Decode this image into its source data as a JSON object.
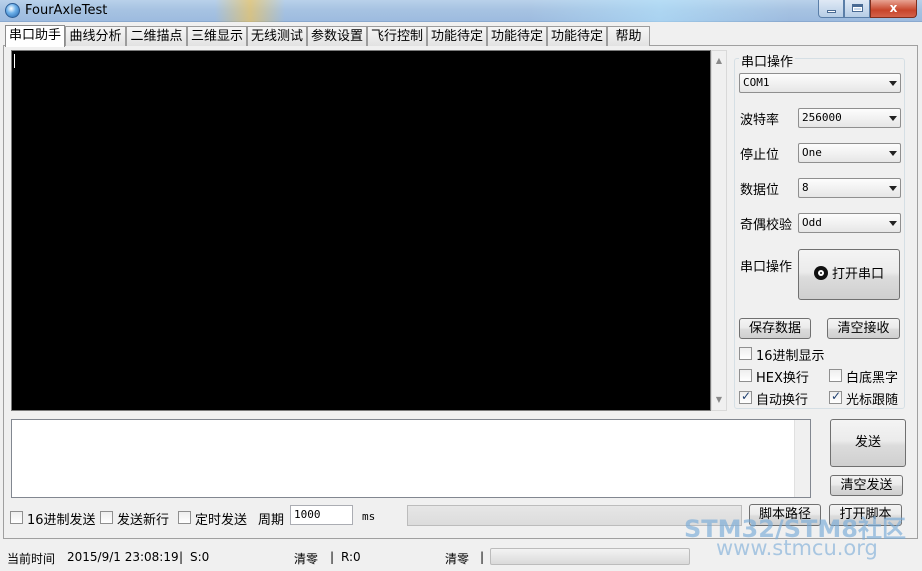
{
  "window": {
    "title": "FourAxleTest",
    "controls": {
      "minimize": "",
      "maximize": "",
      "close": "x"
    }
  },
  "tabs": [
    {
      "label": "串口助手",
      "active": true
    },
    {
      "label": "曲线分析"
    },
    {
      "label": "二维描点"
    },
    {
      "label": "三维显示"
    },
    {
      "label": "无线测试"
    },
    {
      "label": "参数设置"
    },
    {
      "label": "飞行控制"
    },
    {
      "label": "功能待定"
    },
    {
      "label": "功能待定"
    },
    {
      "label": "功能待定"
    },
    {
      "label": "帮助"
    }
  ],
  "serial": {
    "group_title": "串口操作",
    "port_value": "COM1",
    "baud_label": "波特率",
    "baud_value": "256000",
    "stopbits_label": "停止位",
    "stopbits_value": "One",
    "databits_label": "数据位",
    "databits_value": "8",
    "parity_label": "奇偶校验",
    "parity_value": "Odd",
    "op_label": "串口操作",
    "open_button": "打开串口",
    "save_button": "保存数据",
    "clear_recv_button": "清空接收"
  },
  "options": {
    "hex_display": {
      "label": "16进制显示",
      "checked": false
    },
    "hex_newline": {
      "label": "HEX换行",
      "checked": false
    },
    "white_bg": {
      "label": "白底黑字",
      "checked": false
    },
    "auto_newline": {
      "label": "自动换行",
      "checked": true
    },
    "cursor_follow": {
      "label": "光标跟随",
      "checked": true
    }
  },
  "send": {
    "send_button": "发送",
    "clear_send_button": "清空发送",
    "hex_send": {
      "label": "16进制发送",
      "checked": false
    },
    "send_newline": {
      "label": "发送新行",
      "checked": false
    },
    "timed_send": {
      "label": "定时发送",
      "checked": false
    },
    "period_label": "周期",
    "period_value": "1000",
    "period_unit": "ms",
    "script_path_button": "脚本路径",
    "open_script_button": "打开脚本"
  },
  "status": {
    "time_label": "当前时间",
    "time_value": "2015/9/1 23:08:19",
    "sep": "|",
    "sent": "S:0",
    "clear1": "清零",
    "recv": "R:0",
    "clear2": "清零"
  },
  "watermark": {
    "line1": "STM32/STM8社区",
    "line2": "www.stmcu.org"
  }
}
